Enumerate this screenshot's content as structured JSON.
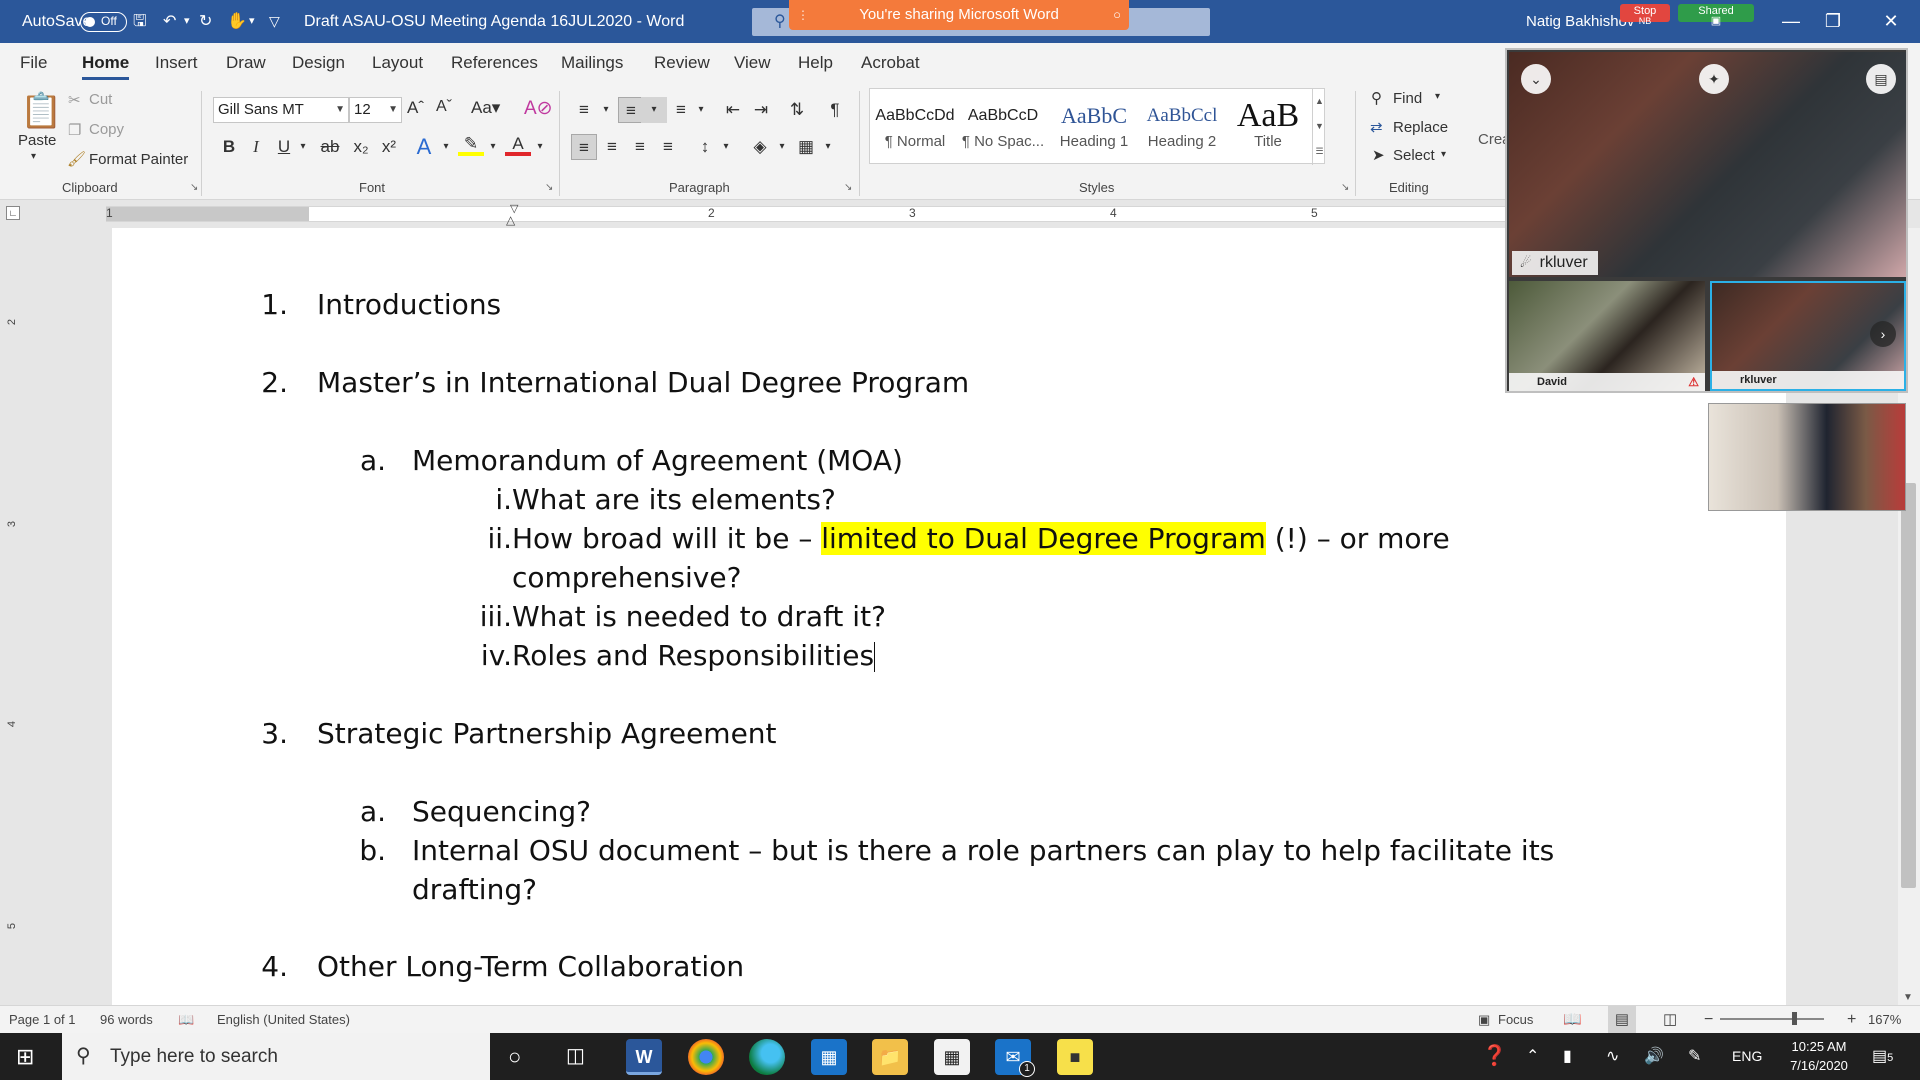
{
  "titlebar": {
    "autosave_label": "AutoSave",
    "autosave_state": "Off",
    "doc_title": "Draft ASAU-OSU Meeting Agenda 16JUL2020  -  Word",
    "sharing_banner": "You're sharing Microsoft Word",
    "user_name": "Natig Bakhishov",
    "stop_label": "Stop",
    "shared_label": "Shared",
    "user_initials": "NB"
  },
  "tabs": [
    "File",
    "Home",
    "Insert",
    "Draw",
    "Design",
    "Layout",
    "References",
    "Mailings",
    "Review",
    "View",
    "Help",
    "Acrobat"
  ],
  "ribbon": {
    "clipboard": {
      "paste": "Paste",
      "cut": "Cut",
      "copy": "Copy",
      "format_painter": "Format Painter",
      "label": "Clipboard"
    },
    "font": {
      "name": "Gill Sans MT",
      "size": "12",
      "label": "Font"
    },
    "paragraph": {
      "label": "Paragraph"
    },
    "styles": {
      "label": "Styles",
      "items": [
        {
          "sample": "AaBbCcDd",
          "name": "¶ Normal"
        },
        {
          "sample": "AaBbCcD",
          "name": "¶ No Spac..."
        },
        {
          "sample": "AaBbC",
          "name": "Heading 1"
        },
        {
          "sample": "AaBbCcl",
          "name": "Heading 2"
        },
        {
          "sample": "AaB",
          "name": "Title"
        }
      ]
    },
    "editing": {
      "find": "Find",
      "replace": "Replace",
      "select": "Select",
      "label": "Editing"
    },
    "create_partial": "Crea"
  },
  "ruler": {
    "numbers": [
      "1",
      "1",
      "2",
      "3",
      "4",
      "5"
    ]
  },
  "vruler": {
    "numbers": [
      "2",
      "3",
      "4",
      "5"
    ]
  },
  "document": {
    "items": [
      {
        "num": "1.",
        "text": "Introductions"
      },
      {
        "num": "2.",
        "text": "Master’s in International Dual Degree Program"
      },
      {
        "num": "a.",
        "text": "Memorandum of Agreement (MOA)"
      },
      {
        "num": "i.",
        "text": "What are its elements?"
      },
      {
        "num": "ii.",
        "text_pre": "How broad will it be – ",
        "text_hl": "limited to Dual Degree Program",
        "text_post": " (!) – or more",
        "cont": "comprehensive?"
      },
      {
        "num": "iii.",
        "text": "What is needed to draft it?"
      },
      {
        "num": "iv.",
        "text": "Roles and Responsibilities"
      },
      {
        "num": "3.",
        "text": "Strategic Partnership Agreement"
      },
      {
        "num": "a.",
        "text": "Sequencing?"
      },
      {
        "num": "b.",
        "text": "Internal OSU document – but is there a role partners can play to help facilitate its",
        "cont": "drafting?"
      },
      {
        "num": "4.",
        "text": "Other Long-Term Collaboration"
      }
    ],
    "highlight_color": "#ffff00"
  },
  "statusbar": {
    "page": "Page 1 of 1",
    "words": "96 words",
    "language": "English (United States)",
    "focus": "Focus",
    "zoom": "167%",
    "zoom_out": "−",
    "zoom_in": "+",
    "zoom_fraction": 0.72
  },
  "taskbar": {
    "search_placeholder": "Type here to search",
    "time": "10:25 AM",
    "date": "7/16/2020",
    "language": "ENG",
    "notification_count": "5",
    "mail_badge": "1"
  },
  "video": {
    "main_speaker": "rkluver",
    "tiles": [
      {
        "name": "David"
      },
      {
        "name": "rkluver"
      }
    ]
  },
  "colors": {
    "word_blue": "#2b579a",
    "share_orange": "#f47a3b",
    "stop_red": "#e2463f",
    "shared_green": "#2f9c4a"
  }
}
